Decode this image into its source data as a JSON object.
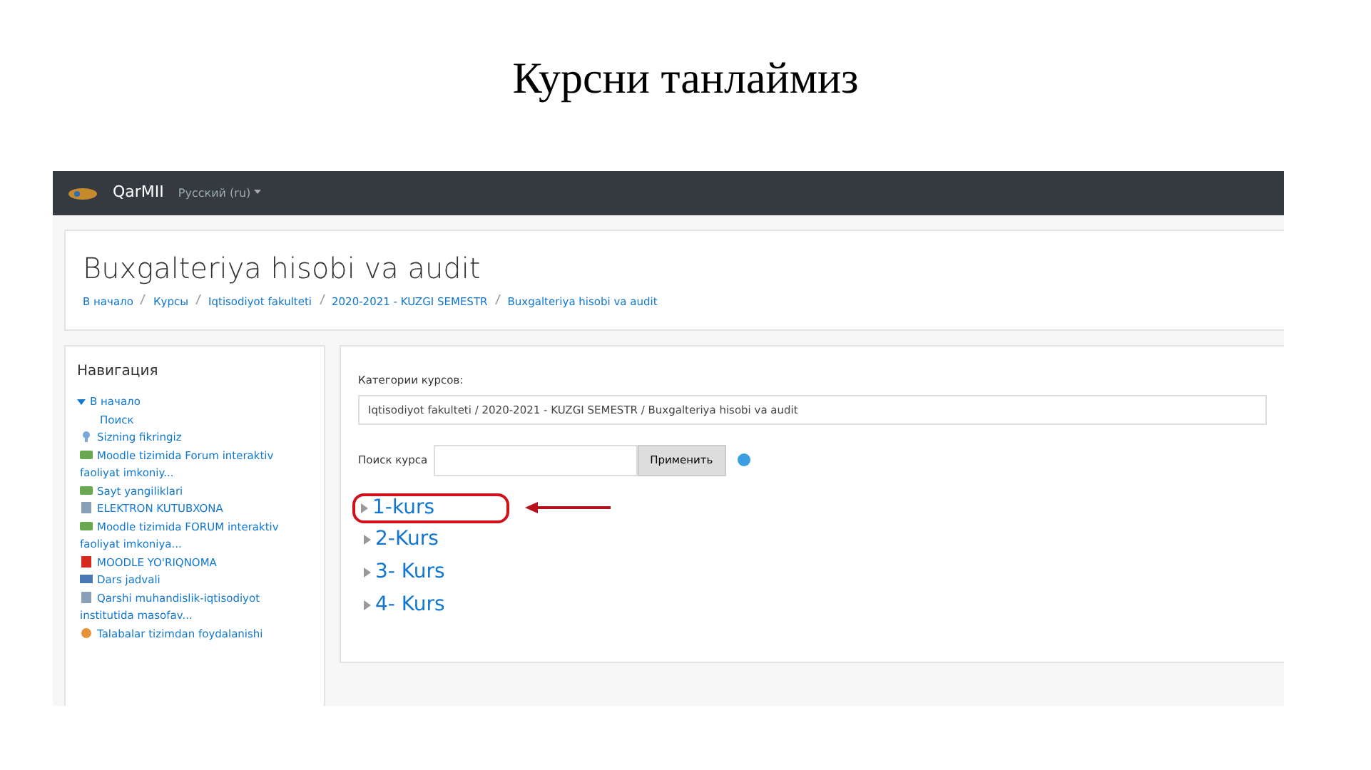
{
  "slide_title": "Курсни танлаймиз",
  "navbar": {
    "site_name": "QarMII",
    "language": "Русский (ru)"
  },
  "header": {
    "title": "Buxgalteriya hisobi va audit",
    "breadcrumb": [
      "В начало",
      "Курсы",
      "Iqtisodiyot fakulteti",
      "2020-2021 - KUZGI SEMESTR",
      "Buxgalteriya hisobi va audit"
    ]
  },
  "navigation": {
    "title": "Навигация",
    "items": [
      {
        "label": "В начало",
        "kind": "parent",
        "expanded": true,
        "children": [
          {
            "label": "Поиск",
            "kind": "plain"
          },
          {
            "label": "Sizning fikringiz",
            "kind": "feedback"
          },
          {
            "label": "Moodle tizimida Forum interaktiv faoliyat imkoniy...",
            "kind": "forum"
          },
          {
            "label": "Sayt yangiliklari",
            "kind": "forum"
          },
          {
            "label": "ELEKTRON KUTUBXONA",
            "kind": "resource"
          },
          {
            "label": "Moodle tizimida FORUM interaktiv faoliyat imkoniya...",
            "kind": "forum"
          },
          {
            "label": "MOODLE YO'RIQNOMA",
            "kind": "pdf"
          },
          {
            "label": "Dars jadvali",
            "kind": "folder"
          },
          {
            "label": "Qarshi muhandislik-iqtisodiyot institutida masofav...",
            "kind": "resource"
          },
          {
            "label": "Talabalar tizimdan foydalanishi",
            "kind": "quiz"
          }
        ]
      }
    ]
  },
  "main": {
    "category_label": "Категории курсов:",
    "category_value": "Iqtisodiyot fakulteti / 2020-2021 - KUZGI SEMESTR / Buxgalteriya hisobi va audit",
    "search_label": "Поиск курса",
    "search_button": "Применить",
    "courses": [
      {
        "label": "1-kurs",
        "expanded": false,
        "annotated": true
      },
      {
        "label": "2-Kurs",
        "expanded": false,
        "annotated": false
      },
      {
        "label": "3- Kurs",
        "expanded": false,
        "annotated": false
      },
      {
        "label": "4- Kurs",
        "expanded": false,
        "annotated": false
      }
    ]
  }
}
